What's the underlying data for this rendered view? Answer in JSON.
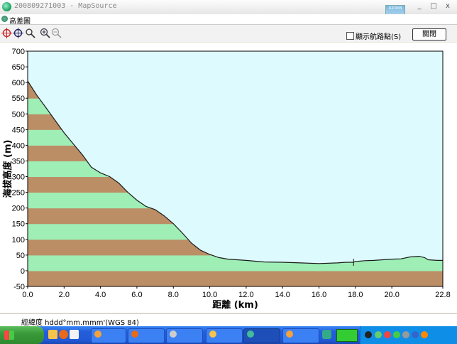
{
  "window": {
    "title": "200809271003 - MapSource",
    "min": "_",
    "max": "□",
    "close": "x"
  },
  "thumbnail": {
    "label": "420kB"
  },
  "dialog": {
    "title": "高差圖"
  },
  "toolbar": {
    "tools": [
      "crosshair-tool-icon",
      "select-tool-icon",
      "lasso-zoom-icon",
      "zoom-in-icon",
      "zoom-out-icon"
    ],
    "show_waypoints_label": "顯示航路點(S)",
    "close_button": "關閉"
  },
  "status": {
    "text": "經緯度 hddd°mm.mmm'(WGS 84)"
  },
  "chart_data": {
    "type": "area",
    "xlabel": "距離 (km)",
    "ylabel": "海拔高度 (m)",
    "xlim": [
      0,
      22.8
    ],
    "ylim": [
      -50,
      700
    ],
    "x_ticks": [
      "0.0",
      "2.0",
      "4.0",
      "6.0",
      "8.0",
      "10.0",
      "12.0",
      "14.0",
      "16.0",
      "18.0",
      "20.0",
      "22.8"
    ],
    "y_ticks": [
      "-50",
      "0",
      "50",
      "100",
      "150",
      "200",
      "250",
      "300",
      "350",
      "400",
      "450",
      "500",
      "550",
      "600",
      "650",
      "700"
    ],
    "band_colors": [
      "#BC8E66",
      "#9EEEB6"
    ],
    "background": "#DDFBFF",
    "series": [
      {
        "x": [
          0,
          0.5,
          1,
          1.5,
          2,
          2.5,
          3,
          3.5,
          4,
          4.5,
          5,
          5.5,
          6,
          6.5,
          7,
          7.5,
          8,
          8.5,
          9,
          9.5,
          10,
          10.5,
          11,
          12,
          13,
          14,
          15,
          16,
          17,
          17.5,
          17.9,
          18,
          18.1,
          18.5,
          19,
          19.5,
          20,
          20.5,
          21,
          21.5,
          21.8,
          22,
          22.5,
          22.8
        ],
        "y": [
          605,
          560,
          520,
          480,
          440,
          405,
          370,
          330,
          312,
          300,
          280,
          250,
          225,
          205,
          195,
          175,
          150,
          120,
          88,
          65,
          52,
          42,
          37,
          33,
          28,
          27,
          25,
          23,
          25,
          27,
          27,
          30,
          30,
          32,
          33,
          35,
          37,
          38,
          44,
          46,
          42,
          35,
          33,
          33
        ]
      }
    ]
  }
}
